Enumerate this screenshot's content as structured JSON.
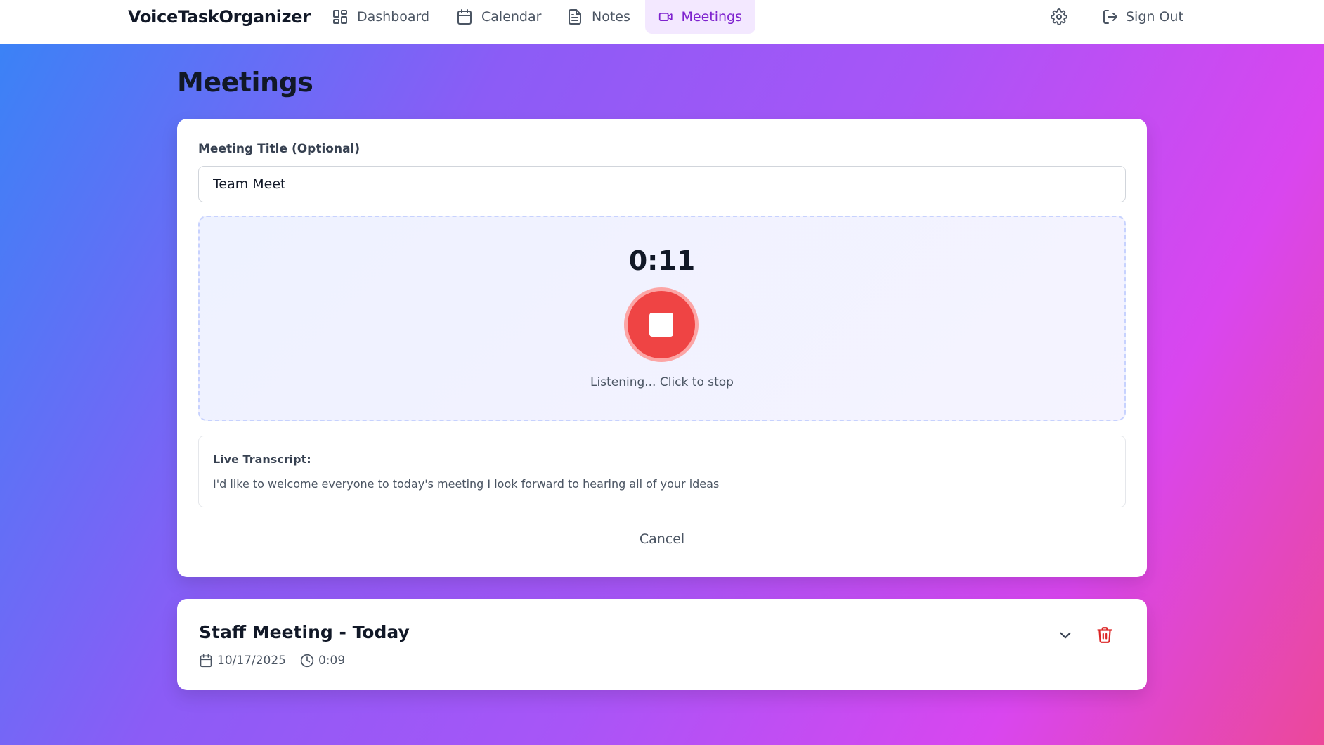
{
  "app": {
    "brand": "VoiceTaskOrganizer"
  },
  "nav": {
    "items": [
      {
        "label": "Dashboard",
        "icon": "layout-dashboard-icon",
        "active": false
      },
      {
        "label": "Calendar",
        "icon": "calendar-icon",
        "active": false
      },
      {
        "label": "Notes",
        "icon": "file-text-icon",
        "active": false
      },
      {
        "label": "Meetings",
        "icon": "video-icon",
        "active": true
      }
    ],
    "settings_icon": "gear-icon",
    "signout_label": "Sign Out",
    "signout_icon": "log-out-icon"
  },
  "page": {
    "title": "Meetings"
  },
  "recorder": {
    "title_label": "Meeting Title (Optional)",
    "title_value": "Team Meet",
    "timer": "0:11",
    "status": "Listening... Click to stop",
    "stop_icon": "stop-icon",
    "transcript_label": "Live Transcript:",
    "transcript_text": "I'd like to welcome everyone to today's meeting I look forward to hearing all of your ideas",
    "cancel_label": "Cancel"
  },
  "meetings": [
    {
      "title": "Staff Meeting - Today",
      "date": "10/17/2025",
      "duration": "0:09"
    }
  ],
  "colors": {
    "accent": "#7e22ce",
    "accent_bg": "#f3e8ff",
    "record_red": "#ef4444",
    "delete_red": "#dc2626",
    "gradient_start": "#3b82f6",
    "gradient_mid": "#a855f7",
    "gradient_end": "#ec4899"
  }
}
